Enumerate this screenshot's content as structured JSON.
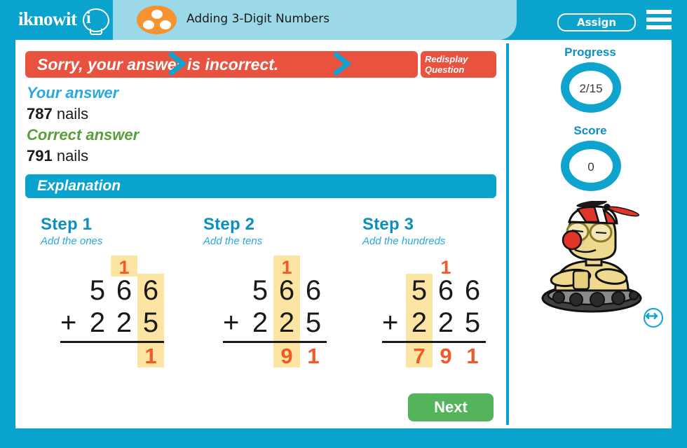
{
  "header": {
    "logo_text": "iknowit",
    "logo_i": "i",
    "tab_title": "Adding 3-Digit Numbers",
    "assign_label": "Assign",
    "menu_icon": "hamburger-menu-icon",
    "logo_icon": "lightbulb-icon",
    "tab_icon": "three-dots-circle-icon"
  },
  "feedback": {
    "result_text": "Sorry, your answer is incorrect.",
    "redisplay_line1": "Redisplay",
    "redisplay_line2": "Question",
    "your_answer_label": "Your answer",
    "your_answer_value": "787",
    "your_answer_unit": " nails",
    "correct_answer_label": "Correct answer",
    "correct_answer_value": "791",
    "correct_answer_unit": " nails",
    "explanation_label": "Explanation"
  },
  "steps": [
    {
      "title": "Step 1",
      "subtitle": "Add the ones",
      "columns": [
        {
          "carry": "",
          "top": "5",
          "bottom": "2",
          "answer": "",
          "highlight": false,
          "plus": true
        },
        {
          "carry": "1",
          "top": "6",
          "bottom": "2",
          "answer": "",
          "highlight": false,
          "carry_highlight": true
        },
        {
          "carry": "",
          "top": "6",
          "bottom": "5",
          "answer": "1",
          "highlight": true
        }
      ]
    },
    {
      "title": "Step 2",
      "subtitle": "Add the tens",
      "columns": [
        {
          "carry": "",
          "top": "5",
          "bottom": "2",
          "answer": "",
          "highlight": false,
          "plus": true
        },
        {
          "carry": "1",
          "top": "6",
          "bottom": "2",
          "answer": "9",
          "highlight": true
        },
        {
          "carry": "",
          "top": "6",
          "bottom": "5",
          "answer": "1",
          "highlight": false
        }
      ]
    },
    {
      "title": "Step 3",
      "subtitle": "Add the hundreds",
      "columns": [
        {
          "carry": "",
          "top": "5",
          "bottom": "2",
          "answer": "7",
          "highlight": true,
          "plus": true
        },
        {
          "carry": "1",
          "top": "6",
          "bottom": "2",
          "answer": "9",
          "highlight": false
        },
        {
          "carry": "",
          "top": "6",
          "bottom": "5",
          "answer": "1",
          "highlight": false
        }
      ]
    }
  ],
  "plus_sign": "+",
  "chevron_icon": "chevron-right-icon",
  "next_label": "Next",
  "sidebar": {
    "progress_label": "Progress",
    "progress_value": "2/15",
    "score_label": "Score",
    "score_value": "0",
    "character_icon": "cartoon-robot-character",
    "resize_icon": "horizontal-resize-icon"
  },
  "colors": {
    "brand_blue": "#0aa3cd",
    "tab_blue": "#9bd9e8",
    "error_red": "#e8523f",
    "correct_green": "#5a9e3a",
    "next_green": "#54b45c",
    "highlight_yellow": "#fce5a2",
    "answer_orange": "#ef5a28",
    "icon_orange": "#f59331"
  }
}
